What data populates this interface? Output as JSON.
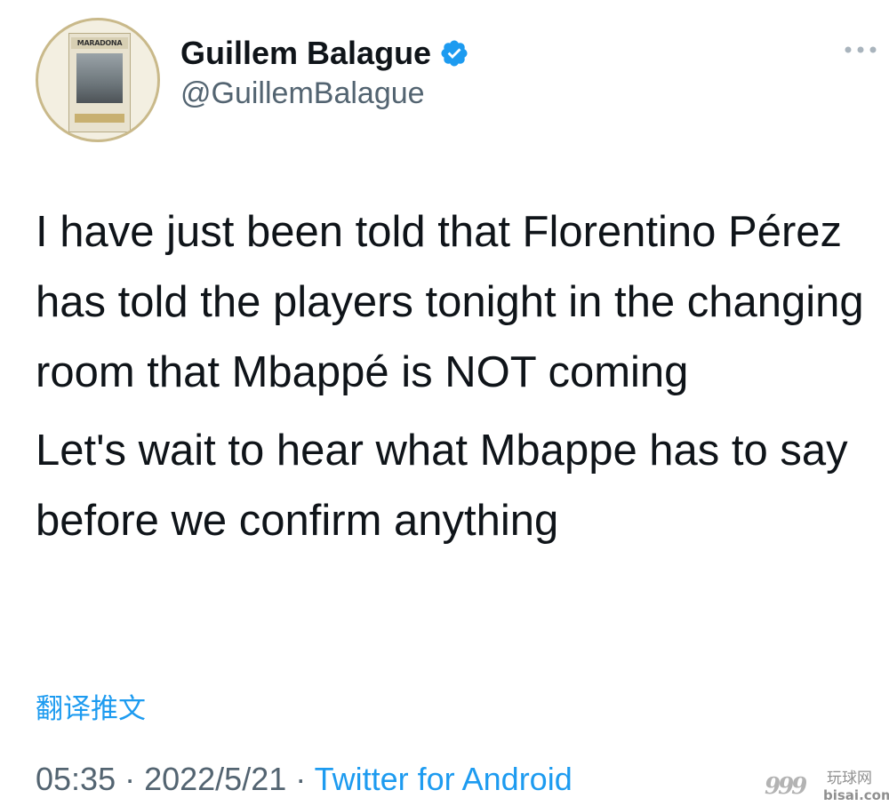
{
  "author": {
    "display_name": "Guillem Balague",
    "handle": "@GuillemBalague",
    "verified": true,
    "avatar_book_title": "MARADONA"
  },
  "tweet": {
    "paragraphs": [
      "I have just been told that Florentino Pérez has told the players tonight in the changing room that Mbappé is NOT coming",
      "Let's wait to hear what Mbappe has to say before we confirm anything"
    ],
    "translate_label": "翻译推文"
  },
  "meta": {
    "time": "05:35",
    "separator": " · ",
    "date": "2022/5/21",
    "source": "Twitter for Android"
  },
  "watermark": {
    "numerals": "999",
    "cn_text": "玩球网",
    "url": "bisai.com"
  },
  "icons": {
    "verified": "verified-badge-icon",
    "more": "more-options-icon"
  },
  "colors": {
    "text": "#0f1419",
    "secondary": "#536471",
    "accent": "#1d9bf0"
  }
}
